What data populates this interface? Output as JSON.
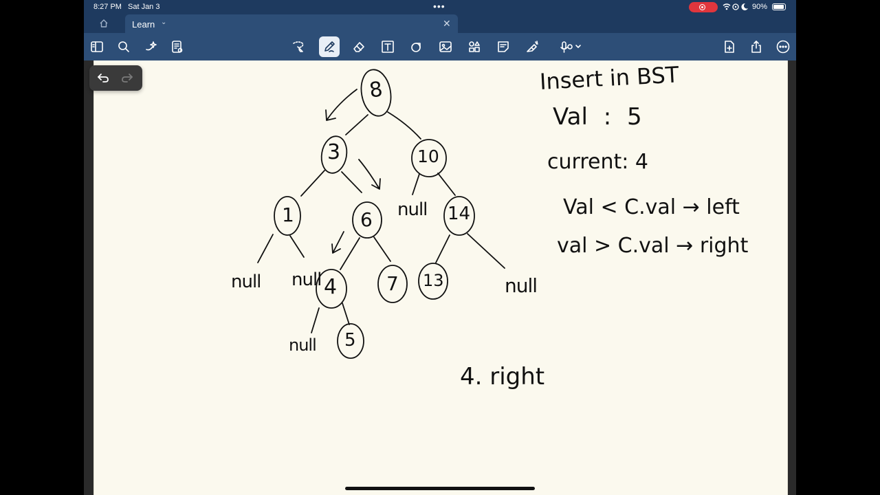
{
  "status_bar": {
    "time": "8:27 PM",
    "date": "Sat Jan 3",
    "battery": "90%"
  },
  "tabs": [
    {
      "label": "Learn"
    }
  ],
  "toolbar": {
    "icons": [
      "sidebar-icon",
      "search-icon",
      "ai-sparkle-icon",
      "document-icon",
      "lasso-icon",
      "pen-icon",
      "eraser-icon",
      "text-box-icon",
      "shapes-icon",
      "image-icon",
      "elements-icon",
      "sticky-note-icon",
      "highlighter-icon",
      "microphone-icon",
      "add-page-icon",
      "share-icon",
      "more-icon"
    ]
  },
  "notes": {
    "title": "Insert in BST",
    "val_line": "Val : 5",
    "current_line": "current: 4",
    "rule_left": "Val < C.val → left",
    "rule_right": "val > C.val → right",
    "step": "4. right"
  },
  "tree": {
    "nodes": [
      "8",
      "3",
      "10",
      "1",
      "6",
      "14",
      "4",
      "7",
      "13",
      "5"
    ],
    "null_labels": [
      "null",
      "null",
      "null",
      "null",
      "null"
    ]
  },
  "colors": {
    "header": "#1e3a5f",
    "toolbar": "#2d4e77",
    "paper": "#fbf9ee",
    "ink": "#111111"
  }
}
